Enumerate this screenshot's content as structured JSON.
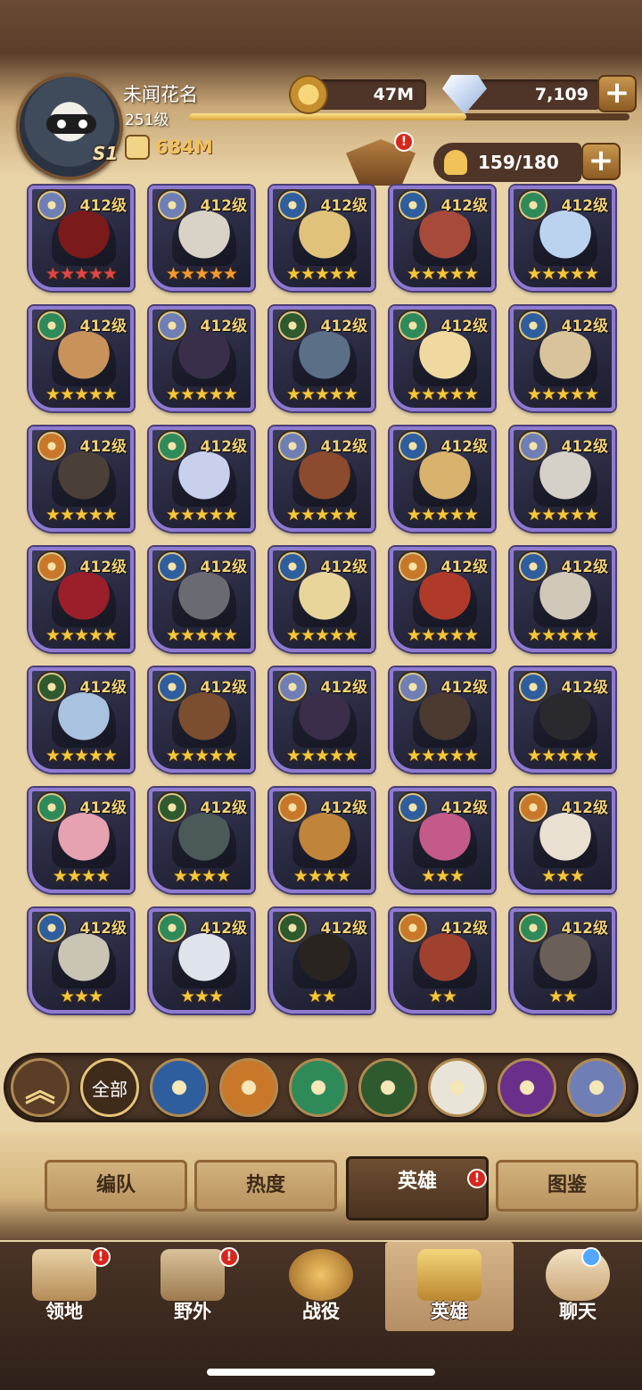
{
  "player": {
    "name": "未闻花名",
    "level": "251级",
    "xp_fraction": 0.63,
    "power": "684M",
    "season_badge": "S1"
  },
  "resources": {
    "gold": "47M",
    "gems": "7,109",
    "plus_symbol": "+"
  },
  "roster": {
    "count": "159/180"
  },
  "heroes": [
    {
      "level": "412级",
      "stars": "★★★★★",
      "star_color": "red",
      "faction": "dimensional",
      "portrait": "#7a1a1a"
    },
    {
      "level": "412级",
      "stars": "★★★★★",
      "star_color": "orange",
      "faction": "dimensional",
      "portrait": "#d9d2c6"
    },
    {
      "level": "412级",
      "stars": "★★★★★",
      "star_color": "gold",
      "faction": "lightbearer",
      "portrait": "#e0c27a"
    },
    {
      "level": "412级",
      "stars": "★★★★★",
      "star_color": "gold",
      "faction": "lightbearer",
      "portrait": "#a84a3a"
    },
    {
      "level": "412级",
      "stars": "★★★★★",
      "star_color": "gold",
      "faction": "wilder-green",
      "portrait": "#bcd3f0"
    },
    {
      "level": "412级",
      "stars": "★★★★★",
      "star_color": "gold",
      "faction": "wilder",
      "portrait": "#c9925a"
    },
    {
      "level": "412级",
      "stars": "★★★★★",
      "star_color": "gold",
      "faction": "dimensional",
      "portrait": "#3a2f4a"
    },
    {
      "level": "412级",
      "stars": "★★★★★",
      "star_color": "gold",
      "faction": "graveborn",
      "portrait": "#5b6f86"
    },
    {
      "level": "412级",
      "stars": "★★★★★",
      "star_color": "gold",
      "faction": "wilder",
      "portrait": "#efd9a0"
    },
    {
      "level": "412级",
      "stars": "★★★★★",
      "star_color": "gold",
      "faction": "lightbearer",
      "portrait": "#d8c39a"
    },
    {
      "level": "412级",
      "stars": "★★★★★",
      "star_color": "gold",
      "faction": "mauler",
      "portrait": "#4a4038"
    },
    {
      "level": "412级",
      "stars": "★★★★★",
      "star_color": "gold",
      "faction": "wilder",
      "portrait": "#c8d0ec"
    },
    {
      "level": "412级",
      "stars": "★★★★★",
      "star_color": "gold",
      "faction": "dimensional",
      "portrait": "#8c4a2e"
    },
    {
      "level": "412级",
      "stars": "★★★★★",
      "star_color": "gold",
      "faction": "lightbearer",
      "portrait": "#d9b26e"
    },
    {
      "level": "412级",
      "stars": "★★★★★",
      "star_color": "gold",
      "faction": "dimensional",
      "portrait": "#d5d0c8"
    },
    {
      "level": "412级",
      "stars": "★★★★★",
      "star_color": "gold",
      "faction": "mauler",
      "portrait": "#9b1f2a"
    },
    {
      "level": "412级",
      "stars": "★★★★★",
      "star_color": "gold",
      "faction": "lightbearer",
      "portrait": "#6a6a72"
    },
    {
      "level": "412级",
      "stars": "★★★★★",
      "star_color": "gold",
      "faction": "lightbearer",
      "portrait": "#e8d59a"
    },
    {
      "level": "412级",
      "stars": "★★★★★",
      "star_color": "gold",
      "faction": "mauler",
      "portrait": "#b03a2a"
    },
    {
      "level": "412级",
      "stars": "★★★★★",
      "star_color": "gold",
      "faction": "lightbearer",
      "portrait": "#cfc7b8"
    },
    {
      "level": "412级",
      "stars": "★★★★★",
      "star_color": "gold",
      "faction": "graveborn",
      "portrait": "#a9c2e0"
    },
    {
      "level": "412级",
      "stars": "★★★★★",
      "star_color": "gold",
      "faction": "lightbearer",
      "portrait": "#7a4e2e"
    },
    {
      "level": "412级",
      "stars": "★★★★★",
      "star_color": "gold",
      "faction": "dimensional",
      "portrait": "#3a2e4a"
    },
    {
      "level": "412级",
      "stars": "★★★★★",
      "star_color": "gold",
      "faction": "dimensional",
      "portrait": "#4a3a30"
    },
    {
      "level": "412级",
      "stars": "★★★★★",
      "star_color": "gold",
      "faction": "lightbearer",
      "portrait": "#2a2a2e"
    },
    {
      "level": "412级",
      "stars": "★★★★",
      "star_color": "gold",
      "faction": "wilder",
      "portrait": "#e6a2b0"
    },
    {
      "level": "412级",
      "stars": "★★★★",
      "star_color": "gold",
      "faction": "graveborn",
      "portrait": "#4b5a58"
    },
    {
      "level": "412级",
      "stars": "★★★★",
      "star_color": "gold",
      "faction": "mauler",
      "portrait": "#c0843a"
    },
    {
      "level": "412级",
      "stars": "★★★",
      "star_color": "gold",
      "faction": "lightbearer",
      "portrait": "#c45a8a"
    },
    {
      "level": "412级",
      "stars": "★★★",
      "star_color": "gold",
      "faction": "mauler",
      "portrait": "#e9e0d2"
    },
    {
      "level": "412级",
      "stars": "★★★",
      "star_color": "gold",
      "faction": "lightbearer",
      "portrait": "#c9c4b4"
    },
    {
      "level": "412级",
      "stars": "★★★",
      "star_color": "gold",
      "faction": "wilder",
      "portrait": "#dfe4ec"
    },
    {
      "level": "412级",
      "stars": "★★",
      "star_color": "gold",
      "faction": "graveborn",
      "portrait": "#2a2420"
    },
    {
      "level": "412级",
      "stars": "★★",
      "star_color": "gold",
      "faction": "mauler",
      "portrait": "#a0402e"
    },
    {
      "level": "412级",
      "stars": "★★",
      "star_color": "gold",
      "faction": "wilder",
      "portrait": "#6a6058"
    }
  ],
  "faction_colors": {
    "lightbearer": "#2f5e9e",
    "mauler": "#c9782a",
    "wilder": "#2f8a5a",
    "wilder-green": "#2f8a5a",
    "graveborn": "#2e5a2e",
    "dimensional": "#6f7fb6",
    "celestial": "#e9e4d8",
    "hypogean": "#6a2f8a"
  },
  "filters": {
    "all_label": "全部",
    "items": [
      {
        "name": "lightbearer",
        "color": "#2f5e9e"
      },
      {
        "name": "mauler",
        "color": "#c9782a"
      },
      {
        "name": "wilder",
        "color": "#2f8a5a"
      },
      {
        "name": "graveborn",
        "color": "#2e5a2e"
      },
      {
        "name": "celestial",
        "color": "#e9e4d8"
      },
      {
        "name": "hypogean",
        "color": "#6a2f8a"
      },
      {
        "name": "dimensional",
        "color": "#6f7fb6"
      }
    ]
  },
  "subtabs": [
    "编队",
    "热度",
    "英雄",
    "图鉴"
  ],
  "nav": [
    "领地",
    "野外",
    "战役",
    "英雄",
    "聊天"
  ],
  "badge_text": "!"
}
